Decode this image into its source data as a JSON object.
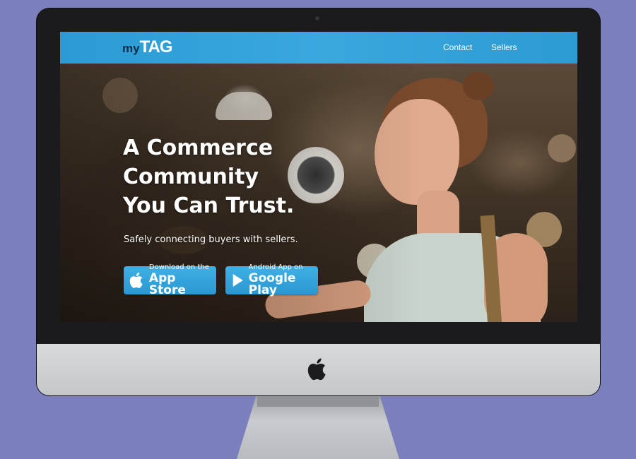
{
  "nav": {
    "logo_my": "my",
    "logo_tag": "TAG",
    "links": [
      "Contact",
      "Sellers"
    ]
  },
  "hero": {
    "headline_lines": [
      "A Commerce",
      "Community",
      "You Can Trust."
    ],
    "subtitle": "Safely connecting buyers with sellers."
  },
  "buttons": {
    "app_store": {
      "small": "Download on the",
      "big": "App Store",
      "icon": "apple-icon"
    },
    "google_play": {
      "small": "Android App on",
      "big": "Google Play",
      "icon": "play-icon"
    }
  },
  "colors": {
    "background": "#7b80bd",
    "navbar": "#2a9bd5",
    "button": "#2b97d0",
    "logo_dark": "#0e2d4a"
  }
}
